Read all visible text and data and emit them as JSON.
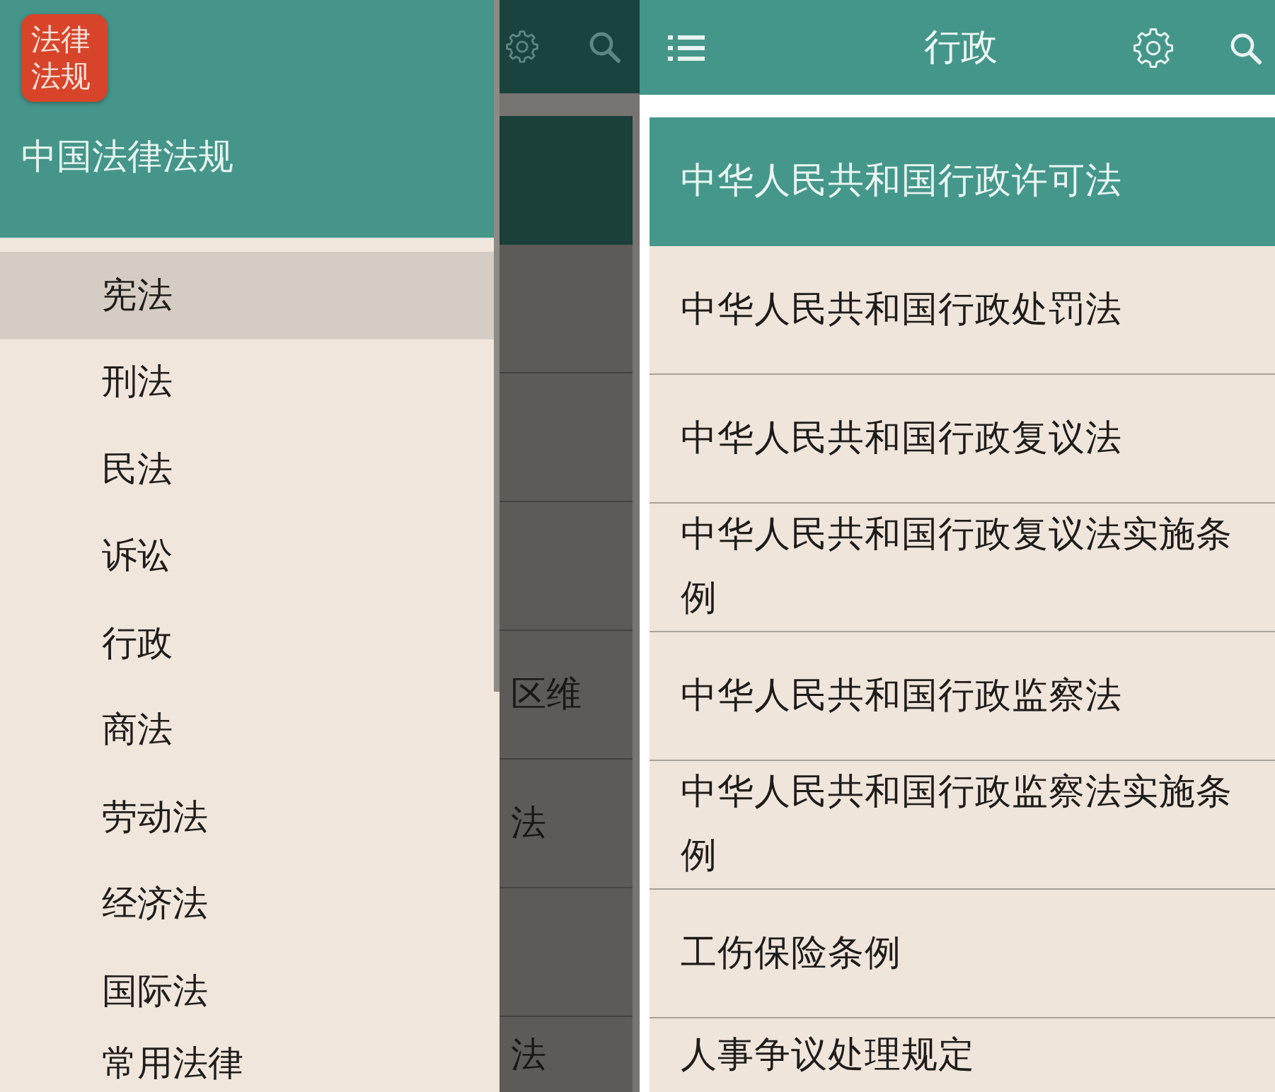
{
  "left_screen": {
    "drawer": {
      "logo_text": "法律法规",
      "title": "中国法律法规",
      "items": [
        {
          "label": "宪法",
          "selected": true
        },
        {
          "label": "刑法",
          "selected": false
        },
        {
          "label": "民法",
          "selected": false
        },
        {
          "label": "诉讼",
          "selected": false
        },
        {
          "label": "行政",
          "selected": false
        },
        {
          "label": "商法",
          "selected": false
        },
        {
          "label": "劳动法",
          "selected": false
        },
        {
          "label": "经济法",
          "selected": false
        },
        {
          "label": "国际法",
          "selected": false
        },
        {
          "label": "常用法律",
          "selected": false
        }
      ]
    },
    "background_list": {
      "rows": [
        {
          "selected": true
        },
        {
          "selected": false
        },
        {
          "selected": false
        },
        {
          "selected": false
        },
        {
          "selected": false,
          "text": "区维"
        },
        {
          "selected": false,
          "text": "法"
        },
        {
          "selected": false
        },
        {
          "selected": false,
          "text": "法"
        }
      ]
    }
  },
  "right_screen": {
    "app_bar": {
      "title": "行政"
    },
    "list": [
      {
        "label": "中华人民共和国行政许可法",
        "selected": true
      },
      {
        "label": "中华人民共和国行政处罚法",
        "selected": false
      },
      {
        "label": "中华人民共和国行政复议法",
        "selected": false
      },
      {
        "label": "中华人民共和国行政复议法实施条例",
        "selected": false
      },
      {
        "label": "中华人民共和国行政监察法",
        "selected": false
      },
      {
        "label": "中华人民共和国行政监察法实施条例",
        "selected": false
      },
      {
        "label": "工伤保险条例",
        "selected": false
      },
      {
        "label": "人事争议处理规定",
        "selected": false
      }
    ]
  }
}
